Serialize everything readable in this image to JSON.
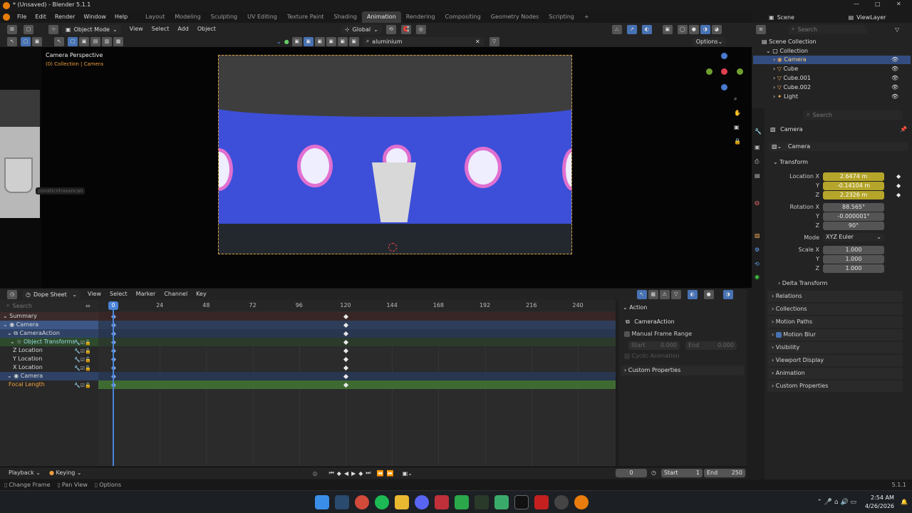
{
  "window": {
    "title": "* (Unsaved) - Blender 5.1.1"
  },
  "menu": [
    "File",
    "Edit",
    "Render",
    "Window",
    "Help"
  ],
  "workspaces": [
    "Layout",
    "Modeling",
    "Sculpting",
    "UV Editing",
    "Texture Paint",
    "Shading",
    "Animation",
    "Rendering",
    "Compositing",
    "Geometry Nodes",
    "Scripting"
  ],
  "active_workspace": "Animation",
  "scene": "Scene",
  "viewlayer": "ViewLayer",
  "viewport": {
    "mode": "Object Mode",
    "menus": [
      "View",
      "Select",
      "Add",
      "Object"
    ],
    "orientation": "Global",
    "search_value": "aluminium",
    "camera_label": "Camera Perspective",
    "collection_label": "(0) Collection | Camera",
    "options": "Options",
    "user_tag": "psnaticnhasancan"
  },
  "outliner": {
    "search_placeholder": "Search",
    "root": "Scene Collection",
    "collection": "Collection",
    "items": [
      "Camera",
      "Cube",
      "Cube.001",
      "Cube.002",
      "Light"
    ]
  },
  "properties": {
    "search_placeholder": "Search",
    "object_name": "Camera",
    "data_name": "Camera",
    "section": "Transform",
    "location": {
      "label": "Location X",
      "x": "2.6474 m",
      "y": "-0.14104 m",
      "z": "2.2326 m"
    },
    "rotation": {
      "label": "Rotation X",
      "x": "88.565°",
      "y": "-0.000001°",
      "z": "90°"
    },
    "mode_label": "Mode",
    "mode": "XYZ Euler",
    "scale": {
      "label": "Scale X",
      "x": "1.000",
      "y": "1.000",
      "z": "1.000"
    },
    "axis_y": "Y",
    "axis_z": "Z",
    "panels": [
      "Delta Transform",
      "Relations",
      "Collections",
      "Motion Paths",
      "Motion Blur",
      "Visibility",
      "Viewport Display",
      "Animation",
      "Custom Properties"
    ]
  },
  "dopesheet": {
    "mode": "Dope Sheet",
    "menus": [
      "View",
      "Select",
      "Marker",
      "Channel",
      "Key"
    ],
    "search_placeholder": "Search",
    "frames": [
      "0",
      "24",
      "48",
      "72",
      "96",
      "120",
      "144",
      "168",
      "192",
      "216",
      "240"
    ],
    "current_frame": "0",
    "channels": [
      "Summary",
      "Camera",
      "CameraAction",
      "Object Transforms",
      "Z Location",
      "Y Location",
      "X Location",
      "Camera",
      "Focal Length"
    ],
    "keyframe_frame": 120,
    "side": {
      "tab": "Action",
      "action": "CameraAction",
      "manual": "Manual Frame Range",
      "start": "Start",
      "start_val": "0.000",
      "end": "End",
      "end_val": "0.000",
      "cyclic": "Cyclic Animation",
      "custom": "Custom Properties"
    }
  },
  "timeline": {
    "playback": "Playback",
    "keying": "Keying",
    "frame": "0",
    "start_label": "Start",
    "start": "1",
    "end_label": "End",
    "end": "250"
  },
  "status": {
    "left": "Change Frame",
    "mid": "Pan View",
    "right": "Options",
    "version": "5.1.1"
  },
  "taskbar": {
    "time": "2:54 AM",
    "date": "4/26/2026"
  }
}
